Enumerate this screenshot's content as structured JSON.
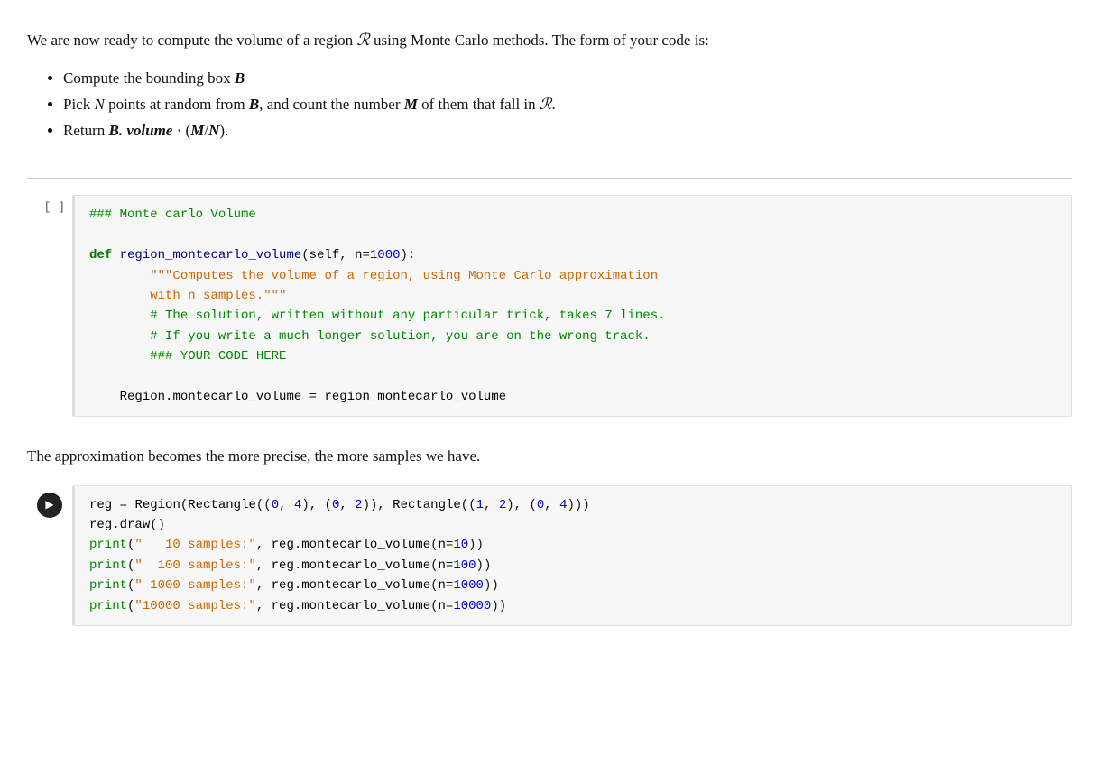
{
  "intro": {
    "paragraph": "We are now ready to compute the volume of a region",
    "region_symbol": "R",
    "rest_of_paragraph": "using Monte Carlo methods. The form of your code is:",
    "bullets": [
      {
        "id": "bullet-1",
        "html": "Compute the bounding box <b><i>B</i></b>"
      },
      {
        "id": "bullet-2",
        "html": "Pick <i>N</i> points at random from <b><i>B</i></b>, and count the number <b><i>M</i></b> of them that fall in <i>ℛ</i>."
      },
      {
        "id": "bullet-3",
        "html": "Return <b><i>B. volume</i></b> · (<b><i>M</i></b>/<b><i>N</i></b>)."
      }
    ]
  },
  "cell1": {
    "counter": "[ ]",
    "code_comment": "### Monte carlo Volume",
    "code_body": "def region_montecarlo_volume(self, n=1000):\n        \"\"\"Computes the volume of a region, using Monte Carlo approximation\n        with n samples.\"\"\"\n        # The solution, written without any particular trick, takes 7 lines.\n        # If you write a much longer solution, you are on the wrong track.\n        ### YOUR CODE HERE\n\n    Region.montecarlo_volume = region_montecarlo_volume"
  },
  "middle_prose": {
    "text": "The approximation becomes the more precise, the more samples we have."
  },
  "cell2": {
    "counter": "",
    "lines": [
      "reg = Region(Rectangle((0, 4), (0, 2)), Rectangle((1, 2), (0, 4)))",
      "reg.draw()",
      "print(\"   10 samples:\", reg.montecarlo_volume(n=10))",
      "print(\"  100 samples:\", reg.montecarlo_volume(n=100))",
      "print(\" 1000 samples:\", reg.montecarlo_volume(n=1000))",
      "print(\"10000 samples:\", reg.montecarlo_volume(n=10000))"
    ]
  }
}
